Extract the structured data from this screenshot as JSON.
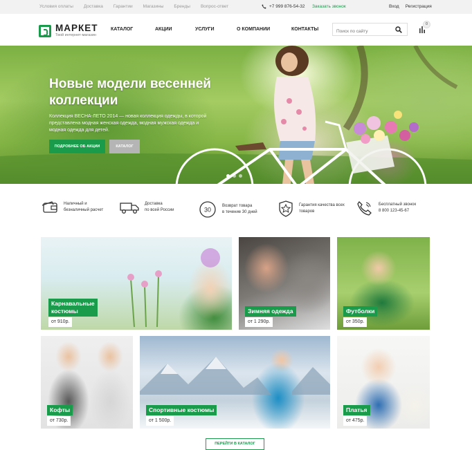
{
  "topbar": {
    "links": [
      "Условия оплаты",
      "Доставка",
      "Гарантии",
      "Магазины",
      "Бренды",
      "Вопрос-ответ"
    ],
    "phone": "+7 999 876-54-32",
    "callback": "Заказать звонок",
    "login": "Вход",
    "register": "Регистрация"
  },
  "header": {
    "logo_name": "МАРКЕТ",
    "logo_sub": "Твой интернет-магазин",
    "nav": [
      "КАТАЛОГ",
      "АКЦИИ",
      "УСЛУГИ",
      "О КОМПАНИИ",
      "КОНТАКТЫ"
    ],
    "search_placeholder": "Поиск по сайту",
    "cart_count": "0"
  },
  "hero": {
    "title": "Новые модели весенней коллекции",
    "description": "Коллекция ВЕСНА-ЛЕТО 2014 — новая коллекция одежды, в которой представлена модная женская одежда, модная мужская одежда и модная одежда для детей.",
    "btn_primary": "ПОДРОБНЕЕ ОБ АКЦИИ",
    "btn_secondary": "КАТАЛОГ",
    "slides": 3,
    "active_slide": 1
  },
  "features": [
    {
      "icon": "wallet-icon",
      "line1": "Наличный и",
      "line2": "безналичный расчет"
    },
    {
      "icon": "truck-icon",
      "line1": "Доставка",
      "line2": "по всей России"
    },
    {
      "icon": "return-30-icon",
      "line1": "Возврат товара",
      "line2": "в течение 30 дней"
    },
    {
      "icon": "quality-star-icon",
      "line1": "Гарантия качества всех",
      "line2": "товаров"
    },
    {
      "icon": "phone-icon",
      "line1": "Бесплатный звонок",
      "line2": "8 800 123-45-67"
    }
  ],
  "tiles": [
    {
      "name_line1": "Карнавальные",
      "name_line2": "костюмы",
      "price": "от 910р."
    },
    {
      "name_line1": "Зимняя одежда",
      "name_line2": "",
      "price": "от 1 290р."
    },
    {
      "name_line1": "Футболки",
      "name_line2": "",
      "price": "от 350р."
    },
    {
      "name_line1": "Кофты",
      "name_line2": "",
      "price": "от 730р."
    },
    {
      "name_line1": "Спортивные костюмы",
      "name_line2": "",
      "price": "от 1 500р."
    },
    {
      "name_line1": "Платья",
      "name_line2": "",
      "price": "от 475р."
    }
  ],
  "catalog_button": "ПЕРЕЙТИ В КАТАЛОГ",
  "colors": {
    "accent": "#1a9a4b",
    "topbar_bg": "#f2f2f2",
    "secondary_btn": "#b5b5b5"
  }
}
